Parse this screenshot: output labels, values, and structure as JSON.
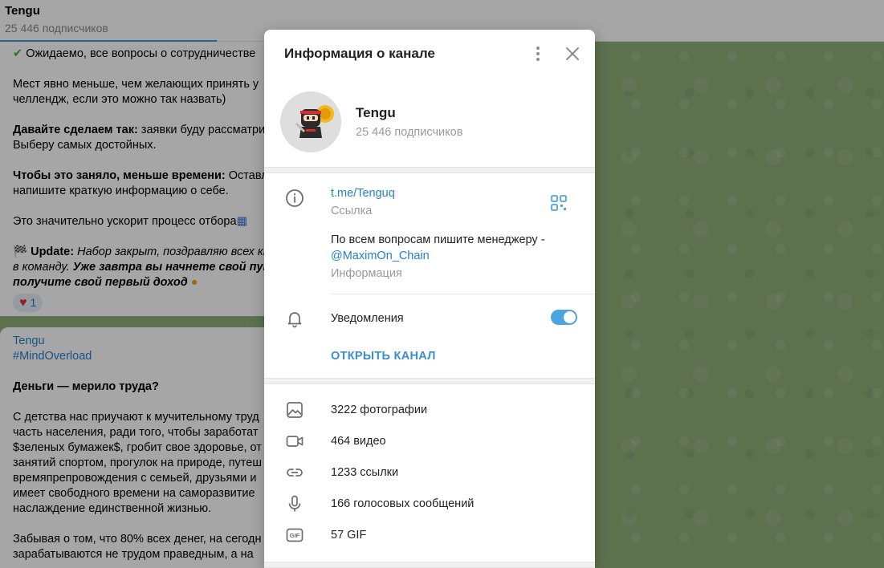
{
  "chat": {
    "title": "Tengu",
    "subscribers": "25 446 подписчиков"
  },
  "message1": {
    "lines": [
      "Ожидаемо, все вопросы о сотрудничестве",
      "Мест явно меньше, чем желающих принять у",
      "челлендж, если это можно так назвать)",
      "Давайте сделаем так:",
      " заявки буду рассматри",
      "Выберу самых достойных.",
      "Чтобы это заняло, меньше времени:",
      " Оставл",
      "напишите краткую информацию о себе.",
      "Это значительно ускорит процесс отбора",
      "Update:",
      " Набор закрыт, поздравляю всех кт",
      "в команду.",
      " Уже завтра вы начнете свой путе",
      "получите свой первый доход"
    ],
    "reaction_count": "1"
  },
  "message2": {
    "author": "Tengu",
    "hashtag": "#MindOverload",
    "heading": "Деньги — мерило труда?",
    "lines": [
      "С детства нас приучают к мучительному труд",
      "часть населения, ради того, чтобы заработат",
      "$зеленых бумажек$, гробит свое здоровье, от",
      "занятий спортом, прогулок на природе, путеш",
      "времяпрепровождения с семьей, друзьями и",
      "имеет свободного времени на саморазвитие",
      "наслаждение единственной жизнью.",
      "Забывая о том, что 80% всех денег, на сегодн",
      "зарабатываются не трудом праведным, а на"
    ]
  },
  "modal": {
    "title": "Информация о канале",
    "channel_name": "Tengu",
    "subscribers": "25 446 подписчиков",
    "link": "t.me/Tenguq",
    "link_caption": "Ссылка",
    "info_text": "По всем вопросам пишите менеджеру -",
    "info_mention": "@MaximOn_Chain",
    "info_caption": "Информация",
    "notifications_label": "Уведомления",
    "notifications_on": true,
    "open_channel": "ОТКРЫТЬ КАНАЛ",
    "media": [
      {
        "icon": "photo-icon",
        "label": "3222 фотографии"
      },
      {
        "icon": "video-icon",
        "label": "464 видео"
      },
      {
        "icon": "link-icon",
        "label": "1233 ссылки"
      },
      {
        "icon": "microphone-icon",
        "label": "166 голосовых сообщений"
      },
      {
        "icon": "gif-icon",
        "label": "57 GIF"
      }
    ]
  },
  "colors": {
    "accent": "#2481cc",
    "toggle": "#4ea4de",
    "chat_bg": "#8fae7a"
  }
}
